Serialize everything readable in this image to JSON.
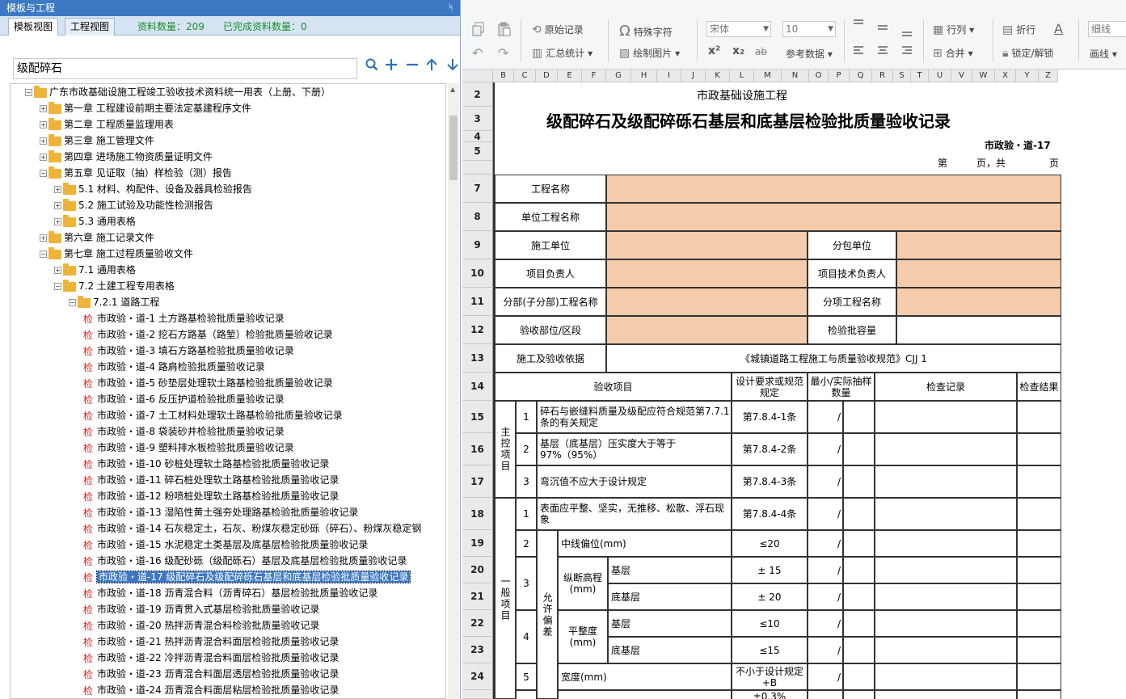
{
  "left_panel": {
    "title": "模板与工程",
    "pin": "ᛋ",
    "tabs": [
      "模板视图",
      "工程视图"
    ],
    "count_label": "资料数量：209",
    "done_label": "已完成资料数量：0",
    "search_value": "级配碎石",
    "tree": [
      {
        "indent": 0,
        "exp": "−",
        "icon": "folder",
        "label": "广东市政基础设施工程竣工验收技术资料统一用表（上册、下册）"
      },
      {
        "indent": 1,
        "exp": "+",
        "icon": "folder",
        "label": "第一章 工程建设前期主要法定基建程序文件"
      },
      {
        "indent": 1,
        "exp": "+",
        "icon": "folder",
        "label": "第二章 工程质量监理用表"
      },
      {
        "indent": 1,
        "exp": "+",
        "icon": "folder",
        "label": "第三章 施工管理文件"
      },
      {
        "indent": 1,
        "exp": "+",
        "icon": "folder",
        "label": "第四章 进场施工物资质量证明文件"
      },
      {
        "indent": 1,
        "exp": "−",
        "icon": "folder",
        "label": "第五章 见证取（抽）样检验（测）报告"
      },
      {
        "indent": 2,
        "exp": "+",
        "icon": "folder",
        "label": "5.1 材料、构配件、设备及器具检验报告"
      },
      {
        "indent": 2,
        "exp": "+",
        "icon": "folder",
        "label": "5.2 施工试验及功能性检测报告"
      },
      {
        "indent": 2,
        "exp": "+",
        "icon": "folder",
        "label": "5.3 通用表格"
      },
      {
        "indent": 1,
        "exp": "+",
        "icon": "folder",
        "label": "第六章 施工记录文件"
      },
      {
        "indent": 1,
        "exp": "−",
        "icon": "folder",
        "label": "第七章 施工过程质量验收文件"
      },
      {
        "indent": 2,
        "exp": "+",
        "icon": "folder",
        "label": "7.1 通用表格"
      },
      {
        "indent": 2,
        "exp": "−",
        "icon": "folder",
        "label": "7.2 土建工程专用表格"
      },
      {
        "indent": 3,
        "exp": "−",
        "icon": "folder",
        "label": "7.2.1 道路工程"
      },
      {
        "indent": 4,
        "exp": "",
        "icon": "leaf",
        "label": "市政验・道-1 土方路基检验批质量验收记录"
      },
      {
        "indent": 4,
        "exp": "",
        "icon": "leaf",
        "label": "市政验・道-2 挖石方路基（路堑）检验批质量验收记录"
      },
      {
        "indent": 4,
        "exp": "",
        "icon": "leaf",
        "label": "市政验・道-3 填石方路基检验批质量验收记录"
      },
      {
        "indent": 4,
        "exp": "",
        "icon": "leaf",
        "label": "市政验・道-4 路肩检验批质量验收记录"
      },
      {
        "indent": 4,
        "exp": "",
        "icon": "leaf",
        "label": "市政验・道-5 砂垫层处理软土路基检验批质量验收记录"
      },
      {
        "indent": 4,
        "exp": "",
        "icon": "leaf",
        "label": "市政验・道-6 反压护道检验批质量验收记录"
      },
      {
        "indent": 4,
        "exp": "",
        "icon": "leaf",
        "label": "市政验・道-7 土工材料处理软土路基检验批质量验收记录"
      },
      {
        "indent": 4,
        "exp": "",
        "icon": "leaf",
        "label": "市政验・道-8 袋装砂井检验批质量验收记录"
      },
      {
        "indent": 4,
        "exp": "",
        "icon": "leaf",
        "label": "市政验・道-9 塑料排水板检验批质量验收记录"
      },
      {
        "indent": 4,
        "exp": "",
        "icon": "leaf",
        "label": "市政验・道-10 砂桩处理软土路基检验批质量验收记录"
      },
      {
        "indent": 4,
        "exp": "",
        "icon": "leaf",
        "label": "市政验・道-11 碎石桩处理软土路基检验批质量验收记录"
      },
      {
        "indent": 4,
        "exp": "",
        "icon": "leaf",
        "label": "市政验・道-12 粉喷桩处理软土路基检验批质量验收记录"
      },
      {
        "indent": 4,
        "exp": "",
        "icon": "leaf",
        "label": "市政验・道-13 湿陷性黄土强夯处理路基检验批质量验收记录"
      },
      {
        "indent": 4,
        "exp": "",
        "icon": "leaf",
        "label": "市政验・道-14 石灰稳定土，石灰、粉煤灰稳定砂砾（碎石）、粉煤灰稳定钢"
      },
      {
        "indent": 4,
        "exp": "",
        "icon": "leaf",
        "label": "市政验・道-15 水泥稳定土类基层及底基层检验批质量验收记录"
      },
      {
        "indent": 4,
        "exp": "",
        "icon": "leaf",
        "label": "市政验・道-16 级配砂砾（级配砾石）基层及底基层检验批质量验收记录"
      },
      {
        "indent": 4,
        "exp": "",
        "icon": "leaf",
        "label": "市政验・道-17 级配碎石及级配碎砾石基层和底基层检验批质量验收记录",
        "selected": true
      },
      {
        "indent": 4,
        "exp": "",
        "icon": "leaf",
        "label": "市政验・道-18 沥青混合料（沥青碎石）基层检验批质量验收记录"
      },
      {
        "indent": 4,
        "exp": "",
        "icon": "leaf",
        "label": "市政验・道-19 沥青贯入式基层检验批质量验收记录"
      },
      {
        "indent": 4,
        "exp": "",
        "icon": "leaf",
        "label": "市政验・道-20 热拌沥青混合料检验批质量验收记录"
      },
      {
        "indent": 4,
        "exp": "",
        "icon": "leaf",
        "label": "市政验・道-21 热拌沥青混合料面层检验批质量验收记录"
      },
      {
        "indent": 4,
        "exp": "",
        "icon": "leaf",
        "label": "市政验・道-22 冷拌沥青混合料面层检验批质量验收记录"
      },
      {
        "indent": 4,
        "exp": "",
        "icon": "leaf",
        "label": "市政验・道-23 沥青混合料面层透层检验批质量验收记录"
      },
      {
        "indent": 4,
        "exp": "",
        "icon": "leaf",
        "label": "市政验・道-24 沥青混合料面层粘层检验批质量验收记录"
      }
    ],
    "leaf_glyph": "检"
  },
  "toolbar": {
    "start_record": "原始记录",
    "summary_stats": "汇总统计",
    "special_char": "特殊字符",
    "draw_picture": "绘制图片",
    "font_name": "宋体",
    "font_size": "10",
    "superscript": "x²",
    "subscript": "x₂",
    "strikethrough": "ab",
    "ref_data": "参考数据",
    "row_col": "行列",
    "merge": "合并",
    "wrap": "折行",
    "lock_unlock": "锁定/解锁",
    "line_thin": "细线",
    "draw_line": "画线"
  },
  "sheet": {
    "columns": [
      "B",
      "C",
      "D",
      "E",
      "F",
      "G",
      "H",
      "I",
      "J",
      "K",
      "L",
      "M",
      "N",
      "O",
      "P",
      "Q",
      "R",
      "S",
      "T",
      "U",
      "V",
      "W",
      "X",
      "Y",
      "Z"
    ],
    "rows": [
      "2",
      "3",
      "4",
      "5",
      "7",
      "8",
      "9",
      "10",
      "11",
      "12",
      "13",
      "14",
      "15",
      "16",
      "17",
      "18",
      "19",
      "20",
      "21",
      "22",
      "23",
      "24"
    ],
    "org_title": "市政基础设施工程",
    "form_title": "级配碎石及级配碎砾石基层和底基层检验批质量验收记录",
    "form_code": "市政验・道-17",
    "page_prefix": "第",
    "page_mid": "页，共",
    "page_suffix": "页",
    "labels": {
      "project_name": "工程名称",
      "unit_project": "单位工程名称",
      "contractor": "施工单位",
      "subcontractor": "分包单位",
      "project_manager": "项目负责人",
      "tech_manager": "项目技术负责人",
      "sub_project": "分部(子分部)工程名称",
      "item_project": "分项工程名称",
      "location": "验收部位/区段",
      "batch_capacity": "检验批容量",
      "basis_label": "施工及验收依据",
      "basis_value": "《城镇道路工程施工与质量验收规范》CJJ 1",
      "hdr_item": "验收项目",
      "hdr_design": "设计要求或规范规定",
      "hdr_sample": "最小/实际抽样数量",
      "hdr_record": "检查记录",
      "hdr_result": "检查结果",
      "main_items": "主控项目",
      "general_items": "一般项目",
      "allowable_dev": "允许偏差"
    },
    "main_rows": [
      {
        "no": "1",
        "desc": "碎石与嵌缝料质量及级配应符合规范第7.7.1条的有关规定",
        "spec": "第7.8.4-1条",
        "slash": "/"
      },
      {
        "no": "2",
        "desc": "基层（底基层）压实度大于等于97%（95%）",
        "spec": "第7.8.4-2条",
        "slash": "/"
      },
      {
        "no": "3",
        "desc": "弯沉值不应大于设计规定",
        "spec": "第7.8.4-3条",
        "slash": "/"
      }
    ],
    "general_rows": {
      "r1": {
        "no": "1",
        "desc": "表面应平整、坚实，无推移、松散、浮石现象",
        "spec": "第7.8.4-4条",
        "slash": "/"
      },
      "r2": {
        "no": "2",
        "desc": "中线偏位(mm)",
        "spec": "≤20",
        "slash": "/"
      },
      "r3": {
        "no": "3",
        "desc": "纵断高程(mm)",
        "sub1": "基层",
        "spec1": "± 15",
        "sub2": "底基层",
        "spec2": "± 20",
        "slash": "/"
      },
      "r4": {
        "no": "4",
        "desc": "平整度(mm)",
        "sub1": "基层",
        "spec1": "≤10",
        "sub2": "底基层",
        "spec2": "≤15",
        "slash": "/"
      },
      "r5": {
        "no": "5",
        "desc": "宽度(mm)",
        "spec": "不小于设计规定+B",
        "slash": "/"
      },
      "r6_spec": "±0.3%"
    }
  }
}
